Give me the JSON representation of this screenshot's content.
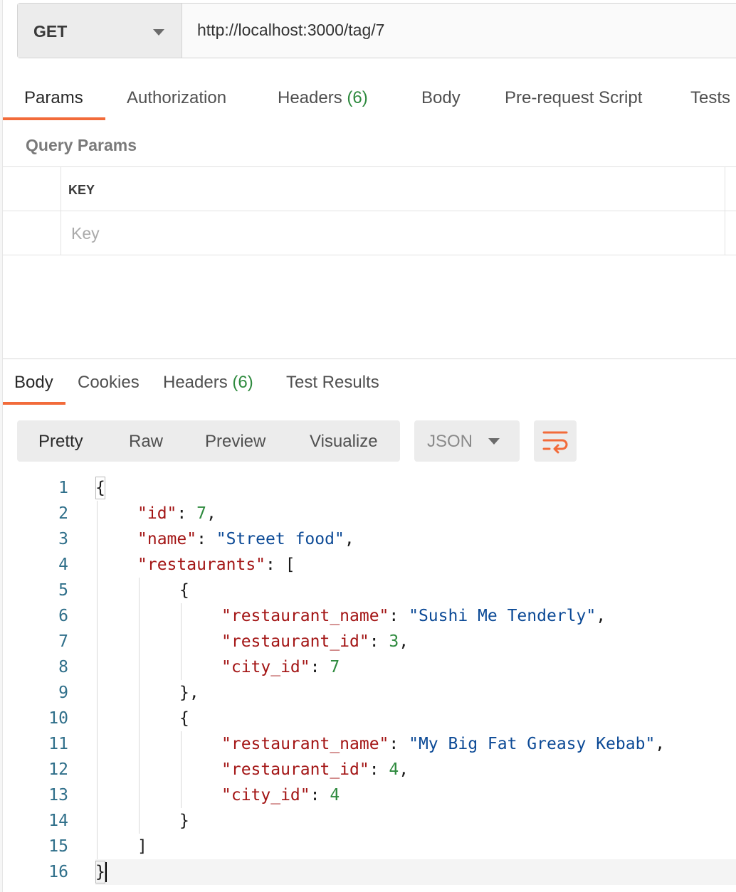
{
  "request": {
    "method": "GET",
    "url": "http://localhost:3000/tag/7"
  },
  "request_tabs": [
    {
      "label": "Params",
      "active": true
    },
    {
      "label": "Authorization"
    },
    {
      "label": "Headers",
      "count": "(6)"
    },
    {
      "label": "Body"
    },
    {
      "label": "Pre-request Script"
    },
    {
      "label": "Tests"
    }
  ],
  "query_params": {
    "title": "Query Params",
    "key_header": "KEY",
    "key_placeholder": "Key"
  },
  "response_tabs": [
    {
      "label": "Body",
      "active": true
    },
    {
      "label": "Cookies"
    },
    {
      "label": "Headers",
      "count": "(6)"
    },
    {
      "label": "Test Results"
    }
  ],
  "view_modes": [
    "Pretty",
    "Raw",
    "Preview",
    "Visualize"
  ],
  "active_view_mode": "Pretty",
  "format": "JSON",
  "icons": {
    "method_dropdown": "chevron-down-icon",
    "format_dropdown": "chevron-down-icon",
    "wrap": "wrap-lines-icon"
  },
  "colors": {
    "accent": "#f26b3a",
    "count": "#2e8a3e",
    "json_key": "#a31515",
    "json_string": "#0c4a96",
    "json_number": "#2e8a3e"
  },
  "code_lines": [
    {
      "n": "1",
      "indent": 0,
      "parts": [
        [
          "p",
          "{"
        ]
      ]
    },
    {
      "n": "2",
      "indent": 1,
      "parts": [
        [
          "k",
          "\"id\""
        ],
        [
          "p",
          ": "
        ],
        [
          "n",
          "7"
        ],
        [
          "p",
          ","
        ]
      ]
    },
    {
      "n": "3",
      "indent": 1,
      "parts": [
        [
          "k",
          "\"name\""
        ],
        [
          "p",
          ": "
        ],
        [
          "s",
          "\"Street food\""
        ],
        [
          "p",
          ","
        ]
      ]
    },
    {
      "n": "4",
      "indent": 1,
      "parts": [
        [
          "k",
          "\"restaurants\""
        ],
        [
          "p",
          ": ["
        ]
      ]
    },
    {
      "n": "5",
      "indent": 2,
      "parts": [
        [
          "p",
          "{"
        ]
      ]
    },
    {
      "n": "6",
      "indent": 3,
      "parts": [
        [
          "k",
          "\"restaurant_name\""
        ],
        [
          "p",
          ": "
        ],
        [
          "s",
          "\"Sushi Me Tenderly\""
        ],
        [
          "p",
          ","
        ]
      ]
    },
    {
      "n": "7",
      "indent": 3,
      "parts": [
        [
          "k",
          "\"restaurant_id\""
        ],
        [
          "p",
          ": "
        ],
        [
          "n",
          "3"
        ],
        [
          "p",
          ","
        ]
      ]
    },
    {
      "n": "8",
      "indent": 3,
      "parts": [
        [
          "k",
          "\"city_id\""
        ],
        [
          "p",
          ": "
        ],
        [
          "n",
          "7"
        ]
      ]
    },
    {
      "n": "9",
      "indent": 2,
      "parts": [
        [
          "p",
          "},"
        ]
      ]
    },
    {
      "n": "10",
      "indent": 2,
      "parts": [
        [
          "p",
          "{"
        ]
      ]
    },
    {
      "n": "11",
      "indent": 3,
      "parts": [
        [
          "k",
          "\"restaurant_name\""
        ],
        [
          "p",
          ": "
        ],
        [
          "s",
          "\"My Big Fat Greasy Kebab\""
        ],
        [
          "p",
          ","
        ]
      ]
    },
    {
      "n": "12",
      "indent": 3,
      "parts": [
        [
          "k",
          "\"restaurant_id\""
        ],
        [
          "p",
          ": "
        ],
        [
          "n",
          "4"
        ],
        [
          "p",
          ","
        ]
      ]
    },
    {
      "n": "13",
      "indent": 3,
      "parts": [
        [
          "k",
          "\"city_id\""
        ],
        [
          "p",
          ": "
        ],
        [
          "n",
          "4"
        ]
      ]
    },
    {
      "n": "14",
      "indent": 2,
      "parts": [
        [
          "p",
          "}"
        ]
      ]
    },
    {
      "n": "15",
      "indent": 1,
      "parts": [
        [
          "p",
          "]"
        ]
      ]
    },
    {
      "n": "16",
      "indent": 0,
      "parts": [
        [
          "p",
          "}"
        ]
      ]
    }
  ]
}
